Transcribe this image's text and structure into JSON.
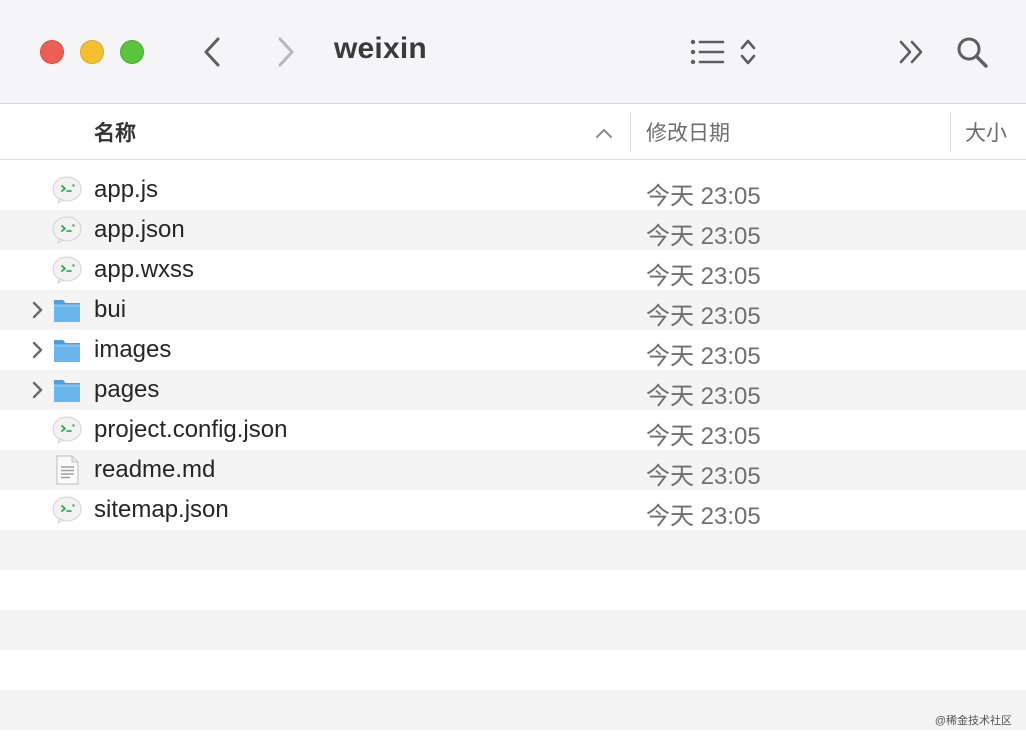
{
  "window": {
    "title": "weixin"
  },
  "toolbar": {
    "back_icon": "chevron-left-icon",
    "forward_icon": "chevron-right-icon",
    "view_icon": "list-view-icon",
    "more_icon": "double-chevron-right-icon",
    "search_icon": "magnifier-icon"
  },
  "columns": {
    "name": "名称",
    "date": "修改日期",
    "size": "大小"
  },
  "files": [
    {
      "name": "app.js",
      "date": "今天 23:05",
      "kind": "wechat",
      "expandable": false
    },
    {
      "name": "app.json",
      "date": "今天 23:05",
      "kind": "wechat",
      "expandable": false
    },
    {
      "name": "app.wxss",
      "date": "今天 23:05",
      "kind": "wechat",
      "expandable": false
    },
    {
      "name": "bui",
      "date": "今天 23:05",
      "kind": "folder",
      "expandable": true
    },
    {
      "name": "images",
      "date": "今天 23:05",
      "kind": "folder",
      "expandable": true
    },
    {
      "name": "pages",
      "date": "今天 23:05",
      "kind": "folder",
      "expandable": true
    },
    {
      "name": "project.config.json",
      "date": "今天 23:05",
      "kind": "wechat",
      "expandable": false
    },
    {
      "name": "readme.md",
      "date": "今天 23:05",
      "kind": "document",
      "expandable": false
    },
    {
      "name": "sitemap.json",
      "date": "今天 23:05",
      "kind": "wechat",
      "expandable": false
    }
  ],
  "watermark": "@稀金技术社区",
  "colors": {
    "close": "#ec5f57",
    "minimize": "#f5bf2f",
    "zoom": "#5ac43f",
    "folder": "#5aa9e6",
    "stripe": "#f4f4f4"
  }
}
